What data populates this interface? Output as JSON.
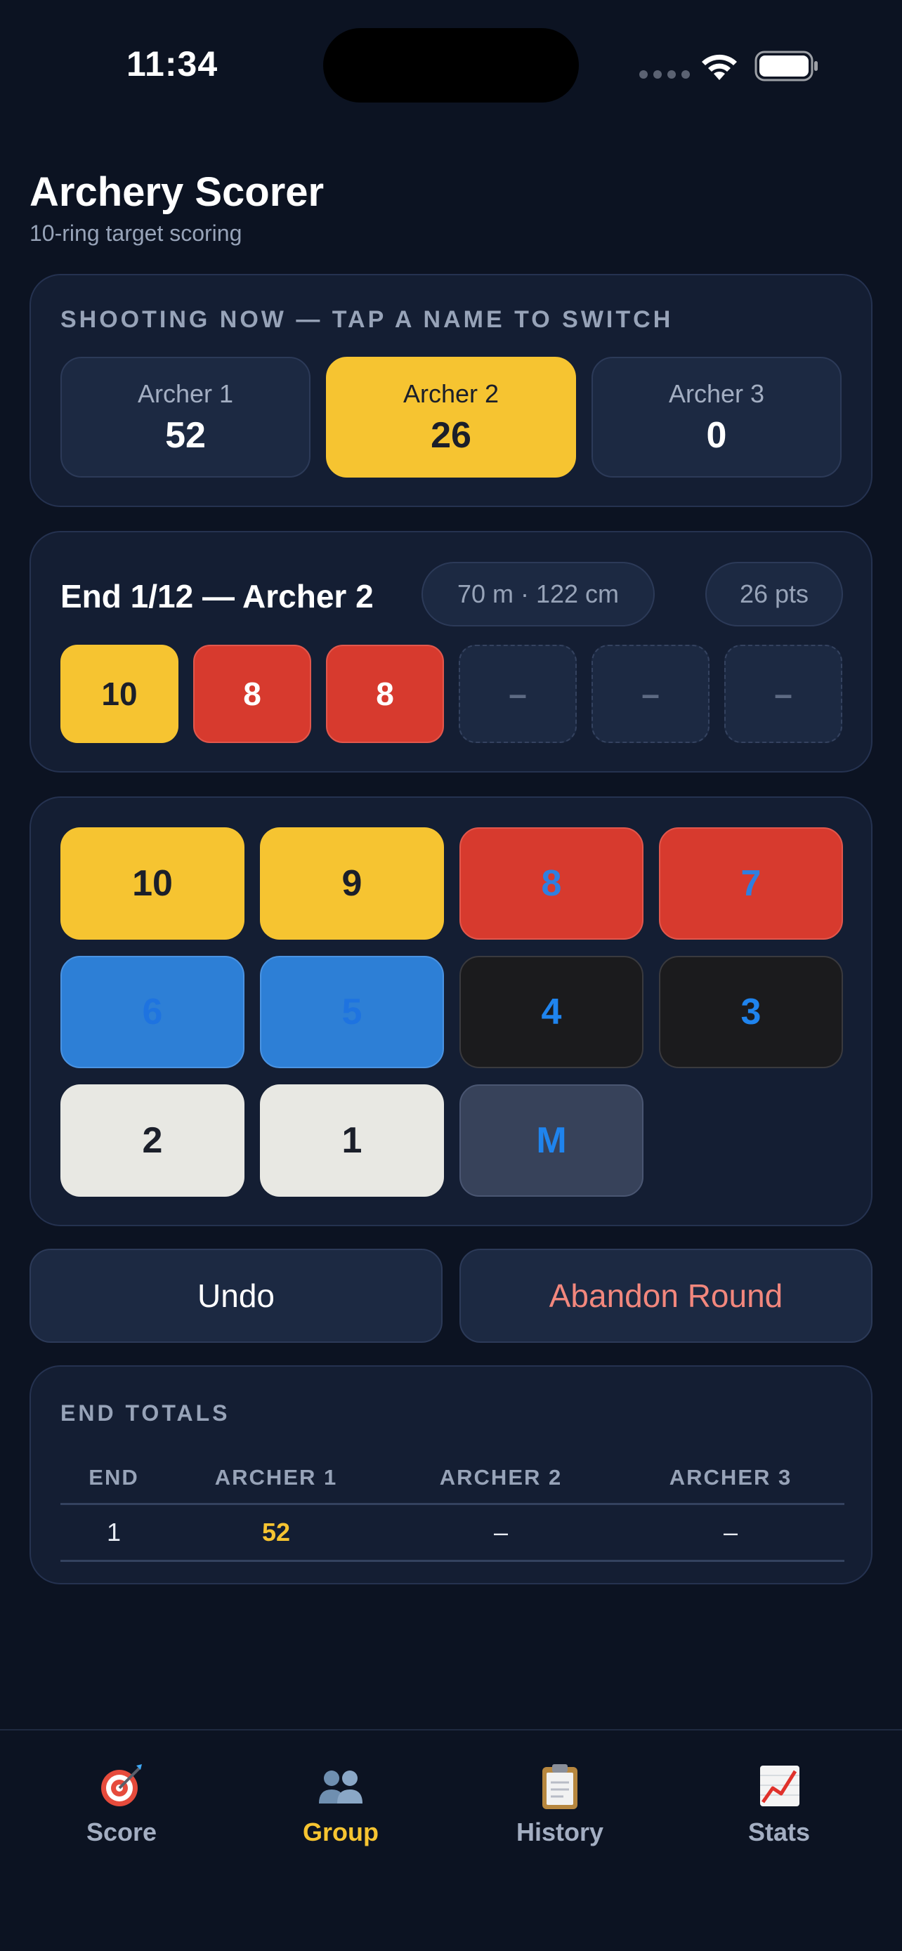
{
  "status_bar": {
    "time": "11:34"
  },
  "header": {
    "title": "Archery Scorer",
    "subtitle": "10-ring target scoring"
  },
  "shooting": {
    "label": "SHOOTING NOW — TAP A NAME TO SWITCH",
    "archers": [
      {
        "name": "Archer 1",
        "score": "52",
        "active": false
      },
      {
        "name": "Archer 2",
        "score": "26",
        "active": true
      },
      {
        "name": "Archer 3",
        "score": "0",
        "active": false
      }
    ]
  },
  "end": {
    "title": "End 1/12 — Archer 2",
    "distance": "70 m · 122 cm",
    "points": "26 pts",
    "arrows": [
      "10",
      "8",
      "8",
      "–",
      "–",
      "–"
    ]
  },
  "keypad": {
    "keys": [
      "10",
      "9",
      "8",
      "7",
      "6",
      "5",
      "4",
      "3",
      "2",
      "1",
      "M"
    ]
  },
  "actions": {
    "undo": "Undo",
    "abandon": "Abandon Round"
  },
  "totals": {
    "label": "END TOTALS",
    "headers": [
      "END",
      "ARCHER 1",
      "ARCHER 2",
      "ARCHER 3"
    ],
    "rows": [
      [
        "1",
        "52",
        "–",
        "–"
      ]
    ]
  },
  "tabs": [
    {
      "label": "Score",
      "icon": "target-icon",
      "active": false
    },
    {
      "label": "Group",
      "icon": "people-icon",
      "active": true
    },
    {
      "label": "History",
      "icon": "clipboard-icon",
      "active": false
    },
    {
      "label": "Stats",
      "icon": "chart-icon",
      "active": false
    }
  ],
  "colors": {
    "background": "#0c1322",
    "card": "#141e33",
    "accent_gold": "#f6c431",
    "ring_red": "#d73a2e",
    "ring_blue": "#2d7fd6",
    "ring_black": "#1b1b1d",
    "ring_white": "#e8e8e3",
    "danger_text": "#f2877d"
  }
}
